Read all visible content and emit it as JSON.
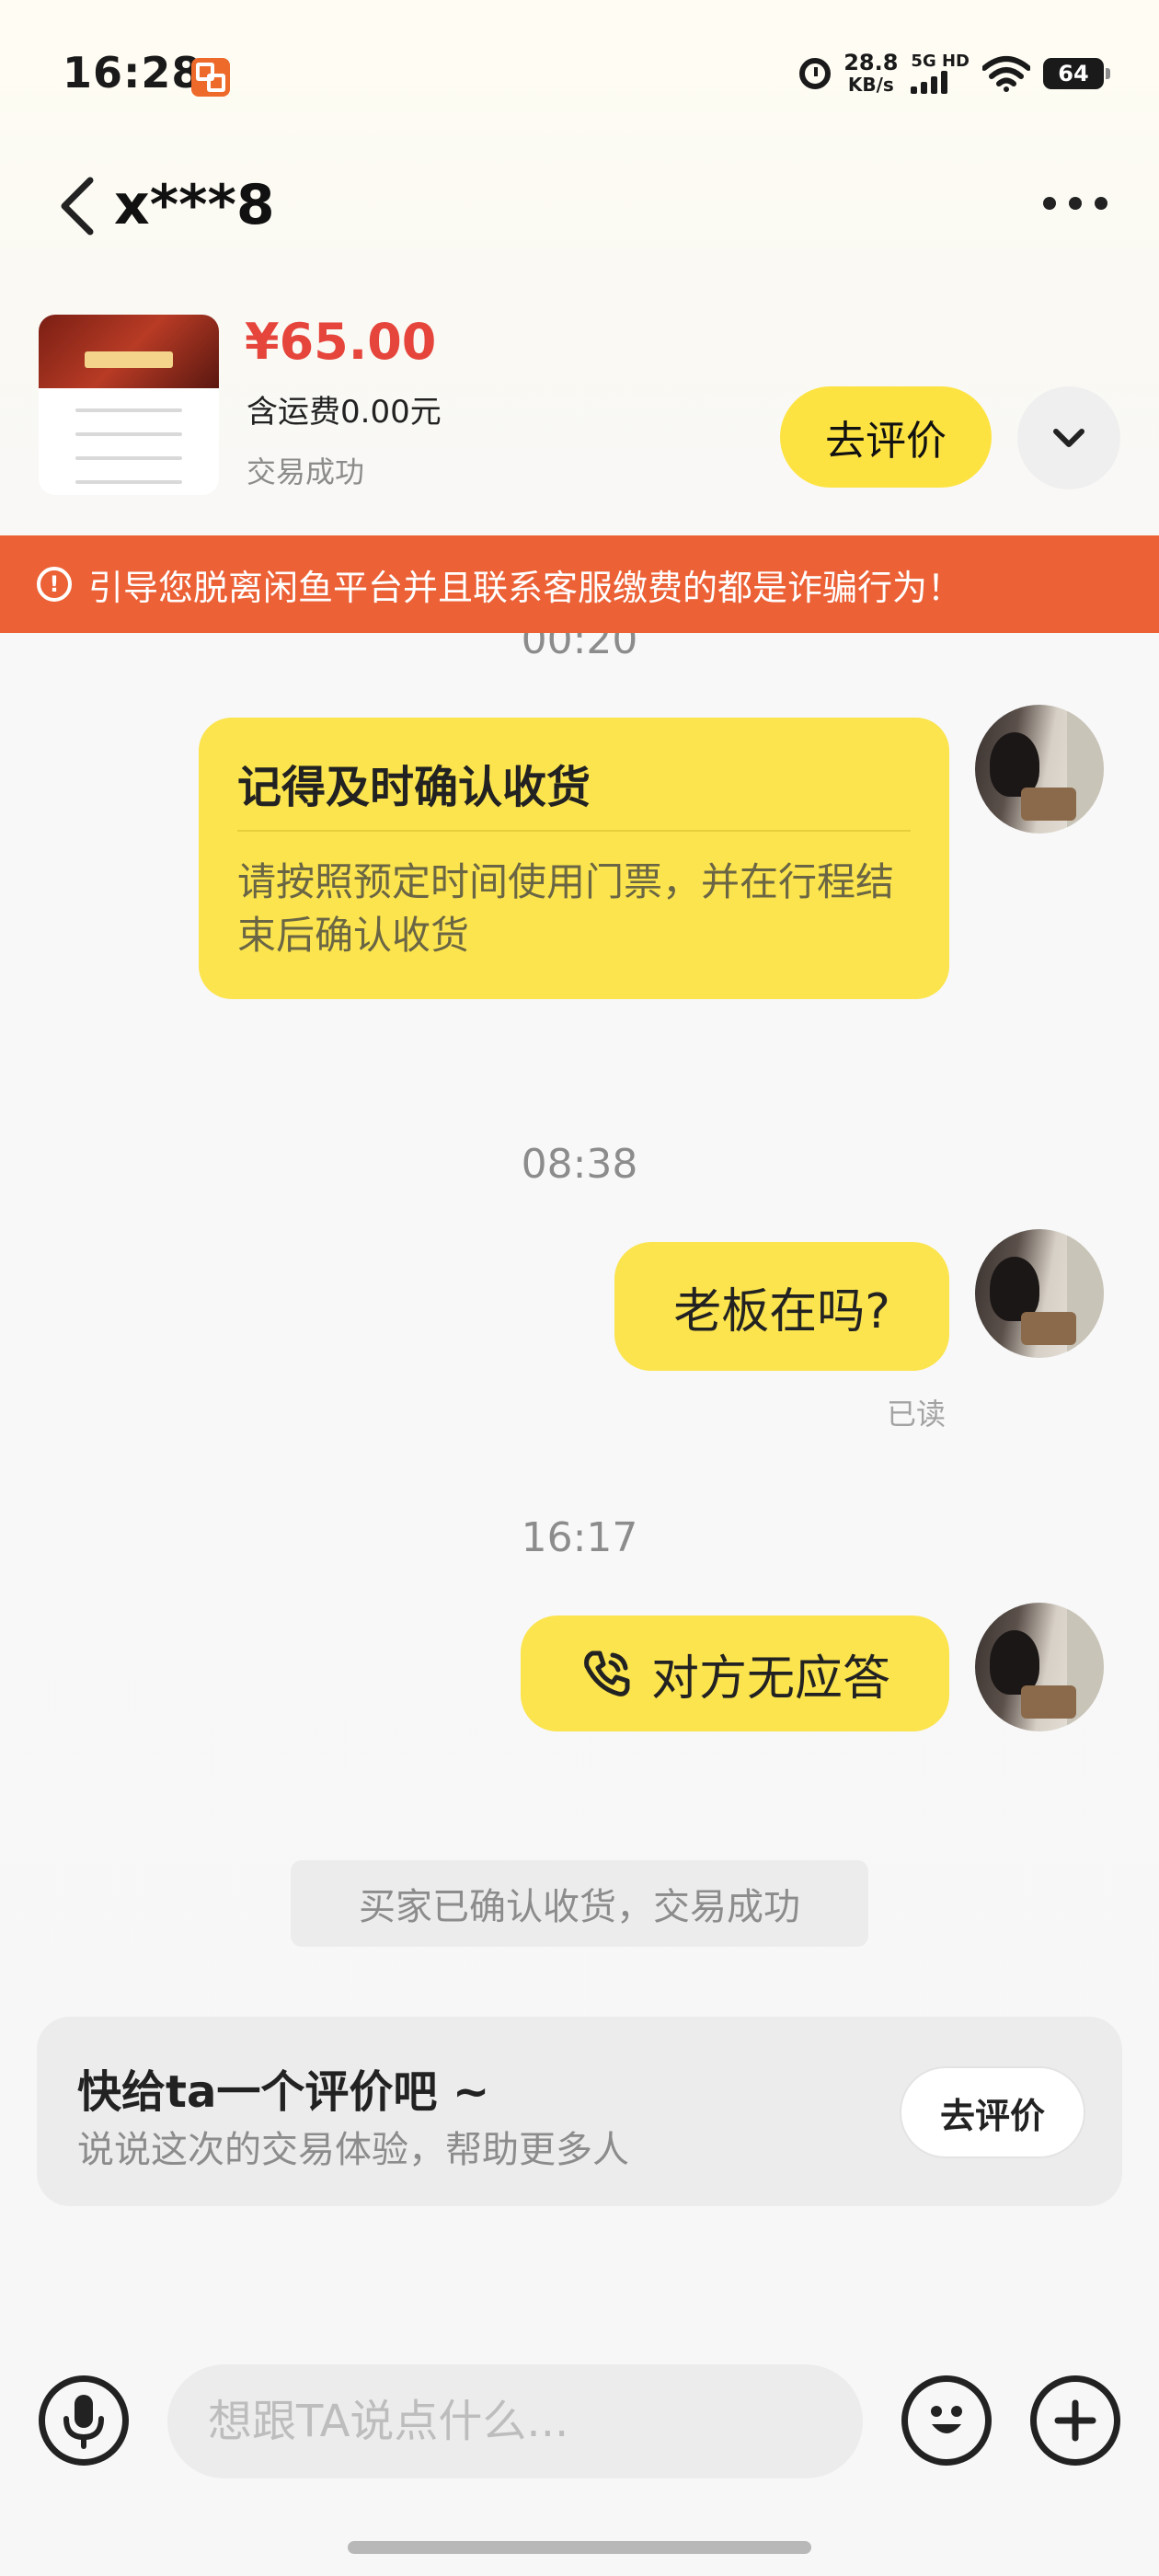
{
  "status_bar": {
    "time": "16:28",
    "net_speed_value": "28.8",
    "net_speed_unit": "KB/s",
    "signal_label": "5G HD",
    "battery": "64",
    "icons": [
      "app-badge-icon",
      "alarm-icon",
      "signal-icon",
      "wifi-icon",
      "battery-icon"
    ]
  },
  "header": {
    "peer_name": "x***8"
  },
  "product": {
    "price": "¥65.00",
    "shipping": "含运费0.00元",
    "status": "交易成功",
    "review_button": "去评价"
  },
  "warning": {
    "text": "引导您脱离闲鱼平台并且联系客服缴费的都是诈骗行为！",
    "color": "#ec6136"
  },
  "chat": {
    "partial_timestamp": "00:20",
    "notice_title": "记得及时确认收货",
    "notice_body": "请按照预定时间使用门票，并在行程结束后确认收货",
    "timestamp_2": "08:38",
    "message_1": "老板在吗?",
    "read_status": "已读",
    "timestamp_3": "16:17",
    "call_text": "对方无应答",
    "system_message": "买家已确认收货，交易成功"
  },
  "rating_prompt": {
    "title": "快给ta一个评价吧 ~",
    "subtitle": "说说这次的交易体验，帮助更多人",
    "button": "去评价"
  },
  "input_bar": {
    "placeholder": "想跟TA说点什么..."
  },
  "colors": {
    "accent_yellow": "#fbe44d",
    "price_red": "#e5453b"
  }
}
